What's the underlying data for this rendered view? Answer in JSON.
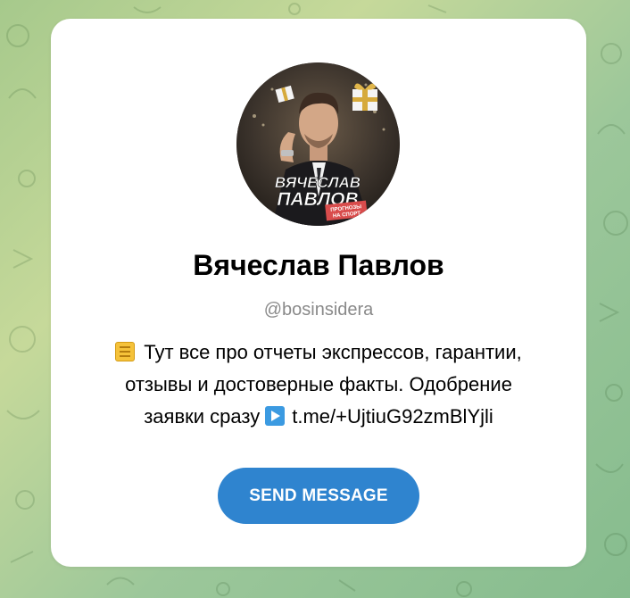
{
  "profile": {
    "name": "Вячеслав Павлов",
    "username": "@bosinsidera",
    "description_line1": "Тут все про отчеты экспрессов, гарантии,",
    "description_line2": "отзывы и достоверные факты. Одобрение",
    "description_line3_prefix": "заявки сразу",
    "description_link": "t.me/+UjtiuG92zmBlYjli",
    "emoji_1": "notebook-icon",
    "emoji_2": "play-button-icon"
  },
  "avatar": {
    "banner_line1": "ВЯЧЕСЛАВ",
    "banner_line2": "ПАВЛОВ",
    "banner_tag_line1": "ПРОГНОЗЫ",
    "banner_tag_line2": "НА СПОРТ"
  },
  "actions": {
    "send_message_label": "SEND MESSAGE"
  },
  "colors": {
    "accent": "#2f84cf",
    "username": "#8a8a8a",
    "background_start": "#a6c98c",
    "background_end": "#86bc8e"
  }
}
